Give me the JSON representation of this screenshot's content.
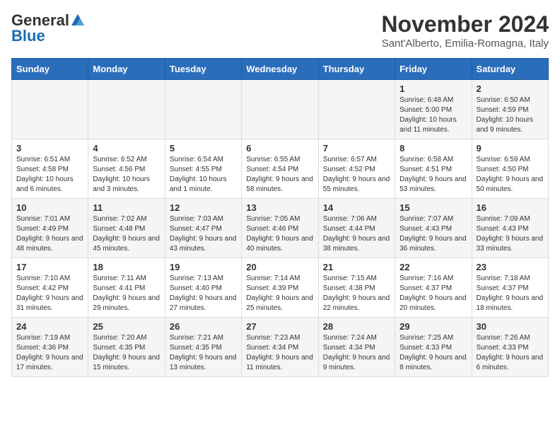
{
  "logo": {
    "general": "General",
    "blue": "Blue"
  },
  "title": "November 2024",
  "subtitle": "Sant'Alberto, Emilia-Romagna, Italy",
  "headers": [
    "Sunday",
    "Monday",
    "Tuesday",
    "Wednesday",
    "Thursday",
    "Friday",
    "Saturday"
  ],
  "rows": [
    [
      {
        "day": "",
        "info": ""
      },
      {
        "day": "",
        "info": ""
      },
      {
        "day": "",
        "info": ""
      },
      {
        "day": "",
        "info": ""
      },
      {
        "day": "",
        "info": ""
      },
      {
        "day": "1",
        "info": "Sunrise: 6:48 AM\nSunset: 5:00 PM\nDaylight: 10 hours and 11 minutes."
      },
      {
        "day": "2",
        "info": "Sunrise: 6:50 AM\nSunset: 4:59 PM\nDaylight: 10 hours and 9 minutes."
      }
    ],
    [
      {
        "day": "3",
        "info": "Sunrise: 6:51 AM\nSunset: 4:58 PM\nDaylight: 10 hours and 6 minutes."
      },
      {
        "day": "4",
        "info": "Sunrise: 6:52 AM\nSunset: 4:56 PM\nDaylight: 10 hours and 3 minutes."
      },
      {
        "day": "5",
        "info": "Sunrise: 6:54 AM\nSunset: 4:55 PM\nDaylight: 10 hours and 1 minute."
      },
      {
        "day": "6",
        "info": "Sunrise: 6:55 AM\nSunset: 4:54 PM\nDaylight: 9 hours and 58 minutes."
      },
      {
        "day": "7",
        "info": "Sunrise: 6:57 AM\nSunset: 4:52 PM\nDaylight: 9 hours and 55 minutes."
      },
      {
        "day": "8",
        "info": "Sunrise: 6:58 AM\nSunset: 4:51 PM\nDaylight: 9 hours and 53 minutes."
      },
      {
        "day": "9",
        "info": "Sunrise: 6:59 AM\nSunset: 4:50 PM\nDaylight: 9 hours and 50 minutes."
      }
    ],
    [
      {
        "day": "10",
        "info": "Sunrise: 7:01 AM\nSunset: 4:49 PM\nDaylight: 9 hours and 48 minutes."
      },
      {
        "day": "11",
        "info": "Sunrise: 7:02 AM\nSunset: 4:48 PM\nDaylight: 9 hours and 45 minutes."
      },
      {
        "day": "12",
        "info": "Sunrise: 7:03 AM\nSunset: 4:47 PM\nDaylight: 9 hours and 43 minutes."
      },
      {
        "day": "13",
        "info": "Sunrise: 7:05 AM\nSunset: 4:46 PM\nDaylight: 9 hours and 40 minutes."
      },
      {
        "day": "14",
        "info": "Sunrise: 7:06 AM\nSunset: 4:44 PM\nDaylight: 9 hours and 38 minutes."
      },
      {
        "day": "15",
        "info": "Sunrise: 7:07 AM\nSunset: 4:43 PM\nDaylight: 9 hours and 36 minutes."
      },
      {
        "day": "16",
        "info": "Sunrise: 7:09 AM\nSunset: 4:43 PM\nDaylight: 9 hours and 33 minutes."
      }
    ],
    [
      {
        "day": "17",
        "info": "Sunrise: 7:10 AM\nSunset: 4:42 PM\nDaylight: 9 hours and 31 minutes."
      },
      {
        "day": "18",
        "info": "Sunrise: 7:11 AM\nSunset: 4:41 PM\nDaylight: 9 hours and 29 minutes."
      },
      {
        "day": "19",
        "info": "Sunrise: 7:13 AM\nSunset: 4:40 PM\nDaylight: 9 hours and 27 minutes."
      },
      {
        "day": "20",
        "info": "Sunrise: 7:14 AM\nSunset: 4:39 PM\nDaylight: 9 hours and 25 minutes."
      },
      {
        "day": "21",
        "info": "Sunrise: 7:15 AM\nSunset: 4:38 PM\nDaylight: 9 hours and 22 minutes."
      },
      {
        "day": "22",
        "info": "Sunrise: 7:16 AM\nSunset: 4:37 PM\nDaylight: 9 hours and 20 minutes."
      },
      {
        "day": "23",
        "info": "Sunrise: 7:18 AM\nSunset: 4:37 PM\nDaylight: 9 hours and 18 minutes."
      }
    ],
    [
      {
        "day": "24",
        "info": "Sunrise: 7:19 AM\nSunset: 4:36 PM\nDaylight: 9 hours and 17 minutes."
      },
      {
        "day": "25",
        "info": "Sunrise: 7:20 AM\nSunset: 4:35 PM\nDaylight: 9 hours and 15 minutes."
      },
      {
        "day": "26",
        "info": "Sunrise: 7:21 AM\nSunset: 4:35 PM\nDaylight: 9 hours and 13 minutes."
      },
      {
        "day": "27",
        "info": "Sunrise: 7:23 AM\nSunset: 4:34 PM\nDaylight: 9 hours and 11 minutes."
      },
      {
        "day": "28",
        "info": "Sunrise: 7:24 AM\nSunset: 4:34 PM\nDaylight: 9 hours and 9 minutes."
      },
      {
        "day": "29",
        "info": "Sunrise: 7:25 AM\nSunset: 4:33 PM\nDaylight: 9 hours and 8 minutes."
      },
      {
        "day": "30",
        "info": "Sunrise: 7:26 AM\nSunset: 4:33 PM\nDaylight: 9 hours and 6 minutes."
      }
    ]
  ]
}
